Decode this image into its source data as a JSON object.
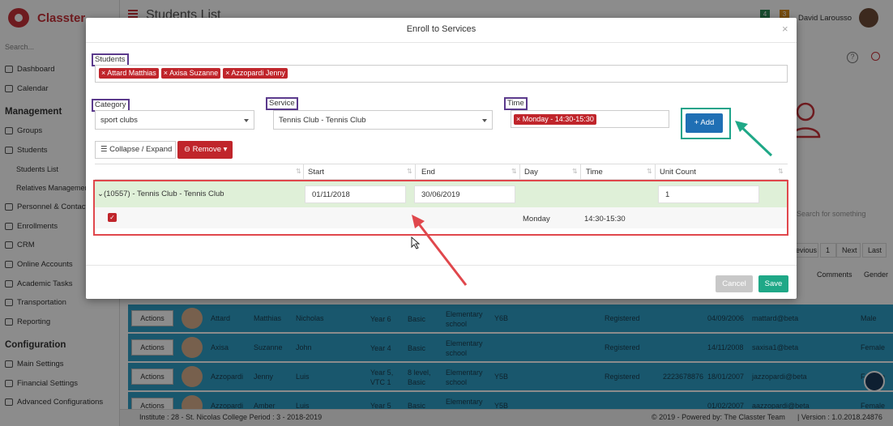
{
  "app": {
    "brand": "Classter",
    "page_title": "Students List",
    "user_name": "David Larousso",
    "badge_a": "4",
    "badge_b": "3"
  },
  "sidebar": {
    "search_placeholder": "Search...",
    "items_top": [
      {
        "label": "Dashboard",
        "icon": "monitor-icon"
      },
      {
        "label": "Calendar",
        "icon": "calendar-icon"
      }
    ],
    "management_heading": "Management",
    "management_items": [
      {
        "label": "Groups",
        "icon": "list-icon"
      },
      {
        "label": "Students",
        "icon": "user-icon"
      }
    ],
    "students_sub": [
      "Students List",
      "Relatives Management"
    ],
    "management_items_2": [
      {
        "label": "Personnel & Contacts",
        "icon": "contacts-icon"
      },
      {
        "label": "Enrollments",
        "icon": "exchange-icon"
      },
      {
        "label": "CRM",
        "icon": "shuffle-icon"
      },
      {
        "label": "Online Accounts",
        "icon": "key-icon"
      },
      {
        "label": "Academic Tasks",
        "icon": "grid-icon"
      },
      {
        "label": "Transportation",
        "icon": "bus-icon"
      },
      {
        "label": "Reporting",
        "icon": "check-icon"
      }
    ],
    "configuration_heading": "Configuration",
    "configuration_items": [
      {
        "label": "Main Settings",
        "icon": "sliders-icon"
      },
      {
        "label": "Financial Settings",
        "icon": "money-icon"
      },
      {
        "label": "Advanced Configurations",
        "icon": "gears-icon"
      }
    ]
  },
  "background": {
    "search_placeholder": "Search for something",
    "pager": {
      "prev": "Previous",
      "page": "1",
      "next": "Next",
      "last": "Last"
    },
    "col_comments": "Comments",
    "col_gender": "Gender",
    "actions_label": "Actions",
    "rows": [
      {
        "last": "Attard",
        "first": "Matthias",
        "middle": "Nicholas",
        "year": "Year 6",
        "level": "Basic",
        "school": "Elementary school",
        "class": "Y6B",
        "status": "Registered",
        "phone": "",
        "dob": "04/09/2006",
        "email": "mattard@beta",
        "gender": "Male"
      },
      {
        "last": "Axisa",
        "first": "Suzanne",
        "middle": "John",
        "year": "Year 4",
        "level": "Basic",
        "school": "Elementary school",
        "class": "",
        "status": "Registered",
        "phone": "",
        "dob": "14/11/2008",
        "email": "saxisa1@beta",
        "gender": "Female"
      },
      {
        "last": "Azzopardi",
        "first": "Jenny",
        "middle": "Luis",
        "year": "Year 5, VTC 1",
        "level": "8 level, Basic",
        "school": "Elementary school",
        "class": "Y5B",
        "status": "Registered",
        "phone": "2223678876",
        "dob": "18/01/2007",
        "email": "jazzopardi@beta",
        "gender": "Female"
      },
      {
        "last": "Azzopardi",
        "first": "Amber",
        "middle": "Luis",
        "year": "Year 5",
        "level": "Basic",
        "school": "Elementary",
        "class": "Y5B",
        "status": "",
        "phone": "",
        "dob": "01/02/2007",
        "email": "aazzopardi@beta",
        "gender": "Female"
      }
    ]
  },
  "footer": {
    "institute": "Institute : 28 - St. Nicolas College  Period : 3 - 2018-2019",
    "copyright": "© 2019 - Powered by: The Classter Team",
    "version": "| Version : 1.0.2018.24876"
  },
  "modal": {
    "title": "Enroll to Services",
    "close": "×",
    "students_label": "Students",
    "students": [
      "Attard Matthias",
      "Axisa Suzanne",
      "Azzopardi Jenny"
    ],
    "category_label": "Category",
    "category_value": "sport clubs",
    "service_label": "Service",
    "service_value": "Tennis Club - Tennis Club",
    "time_label": "Time",
    "time_value": "Monday - 14:30-15:30",
    "add_button": "+ Add",
    "collapse_button": "Collapse / Expand",
    "remove_button": "Remove",
    "columns": [
      "Start",
      "End",
      "Day",
      "Time",
      "Unit Count"
    ],
    "group": {
      "title": "(10557) - Tennis Club - Tennis Club",
      "start": "01/11/2018",
      "end": "30/06/2019",
      "unit_count": "1"
    },
    "entry": {
      "day": "Monday",
      "time": "14:30-15:30"
    },
    "cancel_button": "Cancel",
    "save_button": "Save"
  },
  "colors": {
    "brand_red": "#c8323a",
    "accent_green": "#1fa887",
    "add_blue": "#1f6fb4",
    "annotation_purple": "#5b3a8c",
    "annotation_red": "#e0474c",
    "row_blue": "#2f9fc6"
  }
}
